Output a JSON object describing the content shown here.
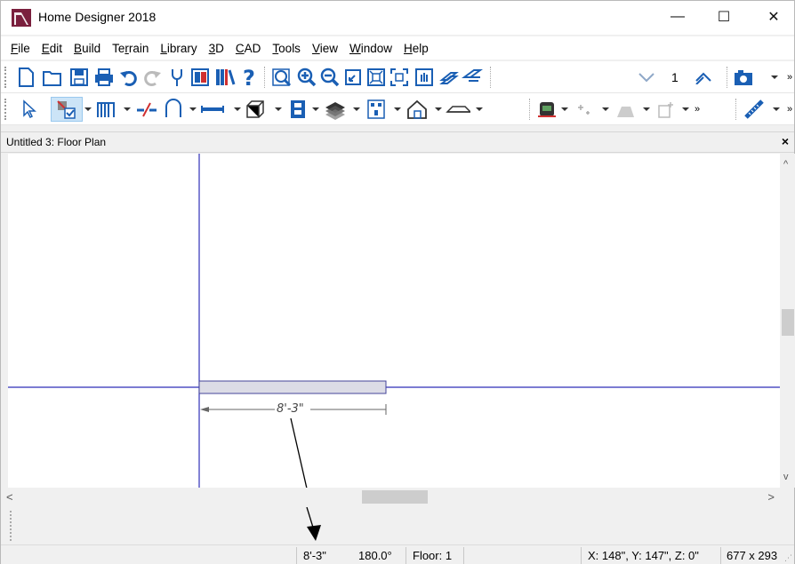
{
  "window": {
    "title": "Home Designer 2018",
    "minimize_glyph": "—",
    "maximize_glyph": "☐",
    "close_glyph": "✕"
  },
  "menu": {
    "items": [
      {
        "label": "File",
        "ul": "F",
        "rest": "ile"
      },
      {
        "label": "Edit",
        "ul": "E",
        "rest": "dit"
      },
      {
        "label": "Build",
        "ul": "B",
        "rest": "uild"
      },
      {
        "label": "Terrain",
        "pre": "Te",
        "ul": "r",
        "rest": "rain"
      },
      {
        "label": "Library",
        "ul": "L",
        "rest": "ibrary"
      },
      {
        "label": "3D",
        "ul": "3",
        "rest": "D"
      },
      {
        "label": "CAD",
        "ul": "C",
        "rest": "AD"
      },
      {
        "label": "Tools",
        "ul": "T",
        "rest": "ools"
      },
      {
        "label": "View",
        "ul": "V",
        "rest": "iew"
      },
      {
        "label": "Window",
        "ul": "W",
        "rest": "indow"
      },
      {
        "label": "Help",
        "ul": "H",
        "rest": "elp"
      }
    ]
  },
  "toolbar1": {
    "floor_number": "1",
    "overflow": "»"
  },
  "toolbar2": {
    "overflow1": "»",
    "overflow2": "»"
  },
  "document": {
    "title": "Untitled 3: Floor Plan",
    "close_glyph": "×"
  },
  "drawing": {
    "dimension_label": "8'-3\""
  },
  "scroll": {
    "up": "^",
    "down": "v",
    "left": "<",
    "right": ">"
  },
  "status": {
    "length": "8'-3\"",
    "angle": "180.0°",
    "floor": "Floor: 1",
    "coordinates": "X: 148\", Y: 147\", Z: 0\"",
    "canvas_size": "677 x 293"
  },
  "colors": {
    "reference_line": "#2f2fb8",
    "wall_fill": "#dcdce6",
    "accent_blue": "#1a5fb4"
  }
}
